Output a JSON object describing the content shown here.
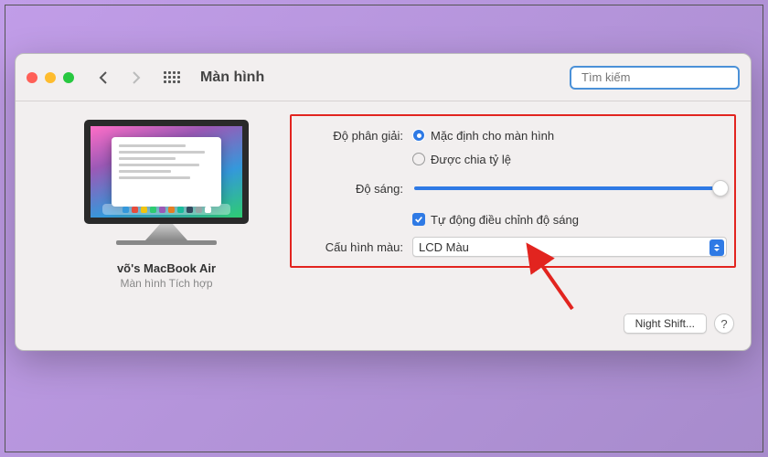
{
  "toolbar": {
    "title": "Màn hình",
    "search_placeholder": "Tìm kiếm"
  },
  "sidebar": {
    "device_name": "võ's MacBook Air",
    "device_sub": "Màn hình Tích hợp"
  },
  "settings": {
    "resolution_label": "Độ phân giải:",
    "resolution_default": "Mặc định cho màn hình",
    "resolution_scaled": "Được chia tỷ lệ",
    "brightness_label": "Độ sáng:",
    "auto_brightness": "Tự động điều chỉnh độ sáng",
    "color_profile_label": "Cấu hình màu:",
    "color_profile_value": "LCD Màu"
  },
  "footer": {
    "night_shift": "Night Shift...",
    "help": "?"
  }
}
